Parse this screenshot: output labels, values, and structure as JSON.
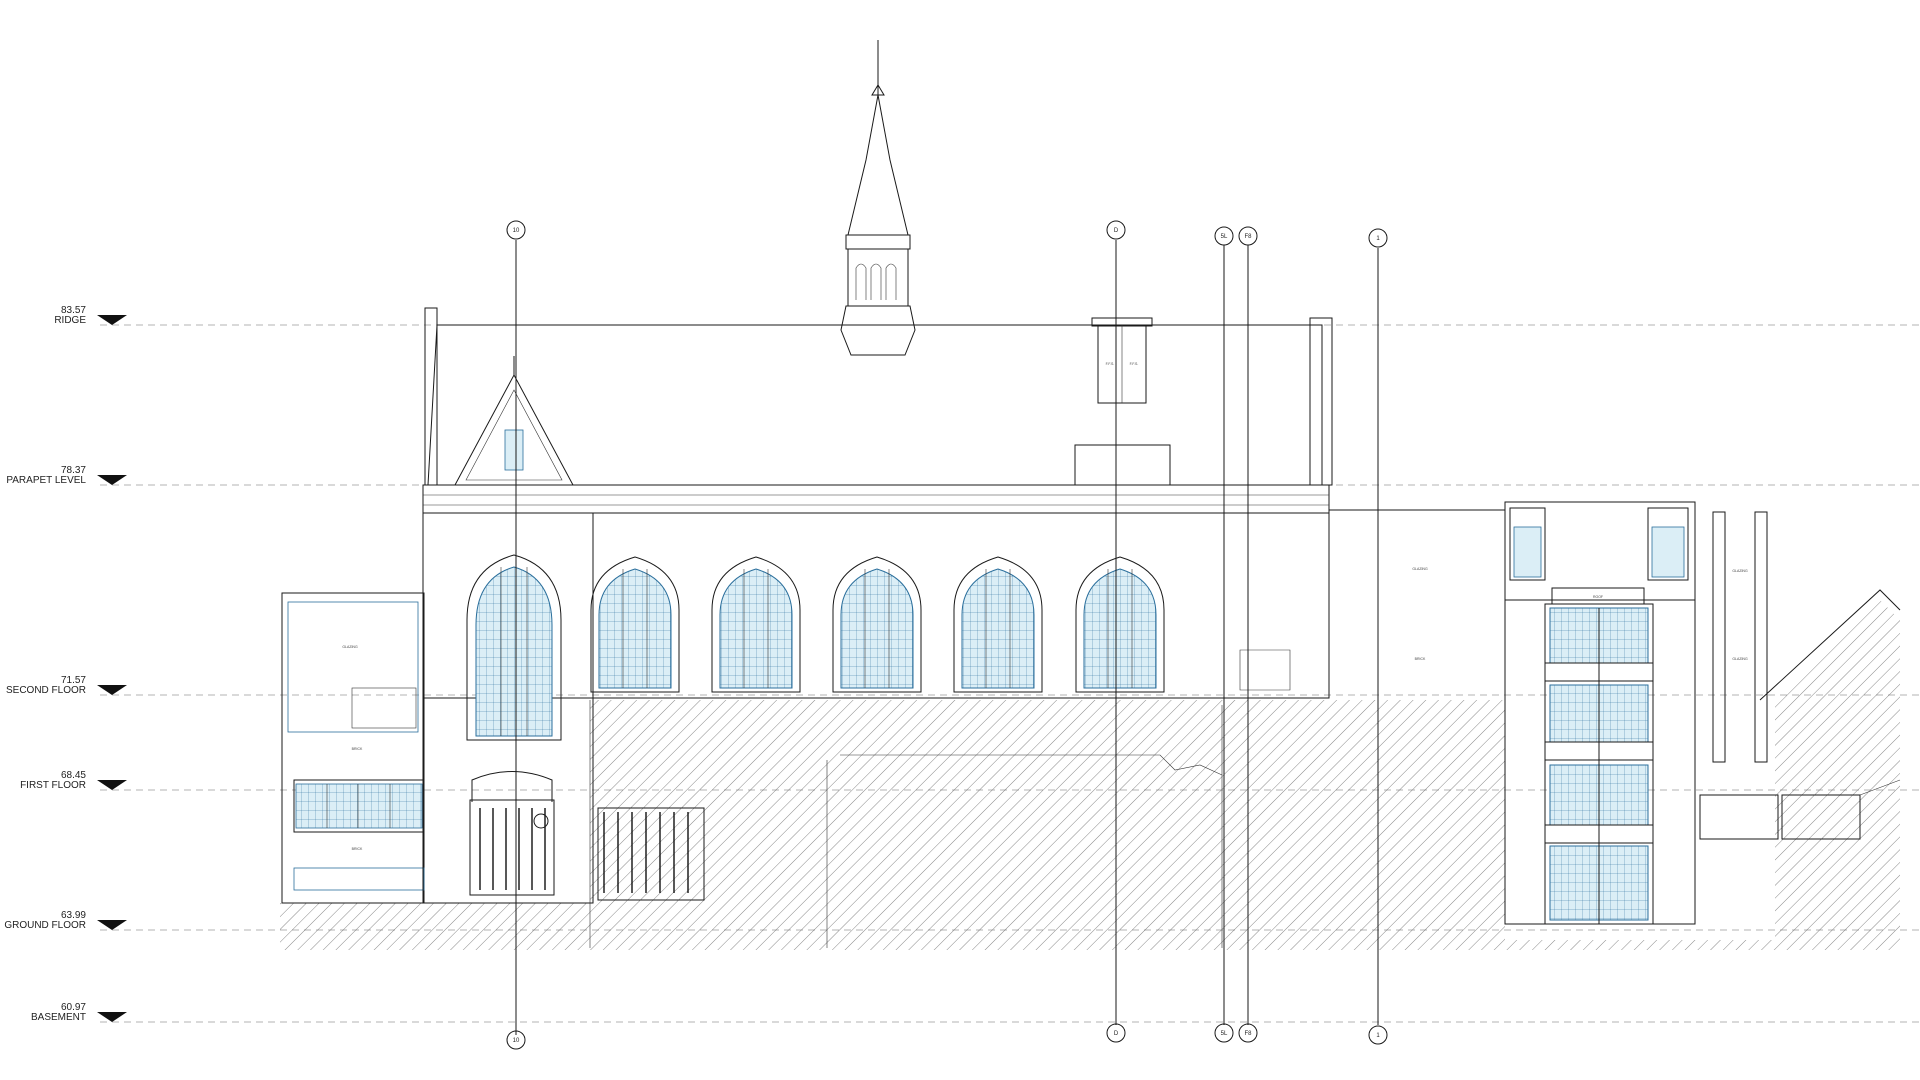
{
  "drawing": {
    "levels": [
      {
        "value": "83.57",
        "name": "RIDGE"
      },
      {
        "value": "78.37",
        "name": "PARAPET LEVEL"
      },
      {
        "value": "71.57",
        "name": "SECOND FLOOR"
      },
      {
        "value": "68.45",
        "name": "FIRST FLOOR"
      },
      {
        "value": "63.99",
        "name": "GROUND FLOOR"
      },
      {
        "value": "60.97",
        "name": "BASEMENT"
      }
    ],
    "gridlines": [
      {
        "label": "10"
      },
      {
        "label": "D"
      },
      {
        "label": "5L"
      },
      {
        "label": "F8"
      },
      {
        "label": "1"
      }
    ],
    "annotations": {
      "chimney_a": "F.F.S.",
      "chimney_b": "F.F.S.",
      "bay_head": "ROOF",
      "left_block_1": "GLAZING",
      "left_block_2": "BRICK",
      "left_block_3": "BRICK",
      "right_panel_1": "GLAZING",
      "right_panel_2": "BRICK",
      "side_panel_1": "GLAZING",
      "side_panel_2": "GLAZING"
    },
    "colors": {
      "line": "#1a1a1a",
      "glass": "#dbeef6",
      "glass_edge": "#2b6f9c",
      "level_guide": "#9a9a9a"
    }
  }
}
